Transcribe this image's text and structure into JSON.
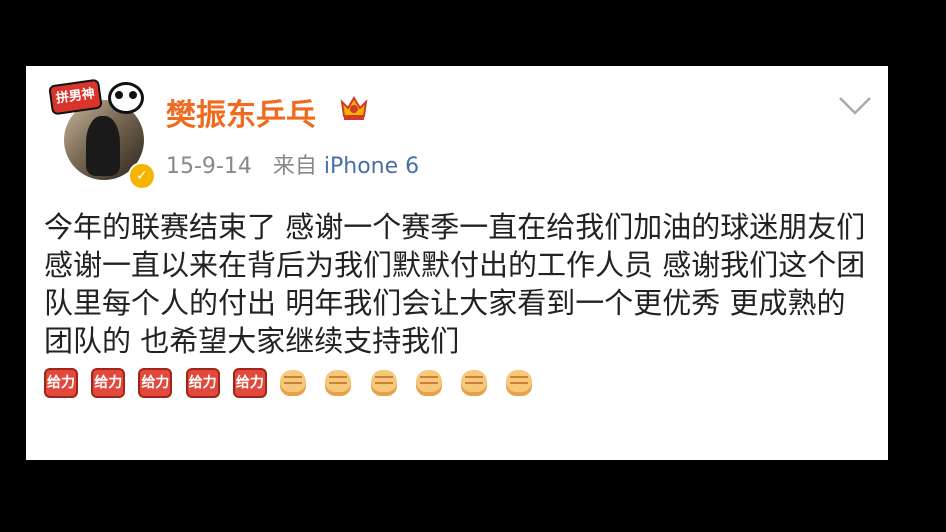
{
  "post": {
    "author": "樊振东乒乓",
    "avatar_badge": "拼男神",
    "date": "15-9-14",
    "source_prefix": "来自",
    "device": "iPhone 6",
    "text": "今年的联赛结束了 感谢一个赛季一直在给我们加油的球迷朋友们 感谢一直以来在背后为我们默默付出的工作人员 感谢我们这个团队里每个人的付出 明年我们会让大家看到一个更优秀 更成熟的团队的 也希望大家继续支持我们",
    "emoji_red": [
      "给力",
      "给力",
      "给力",
      "给力",
      "给力"
    ],
    "emoji_fist_count": 6
  },
  "colors": {
    "name": "#f06b1f",
    "meta": "#888888",
    "device": "#4a6fa5",
    "background": "#000000",
    "card": "#ffffff"
  },
  "icons": {
    "crown": "vip-crown-icon",
    "verified": "verified-badge-icon",
    "menu": "chevron-down-icon"
  }
}
